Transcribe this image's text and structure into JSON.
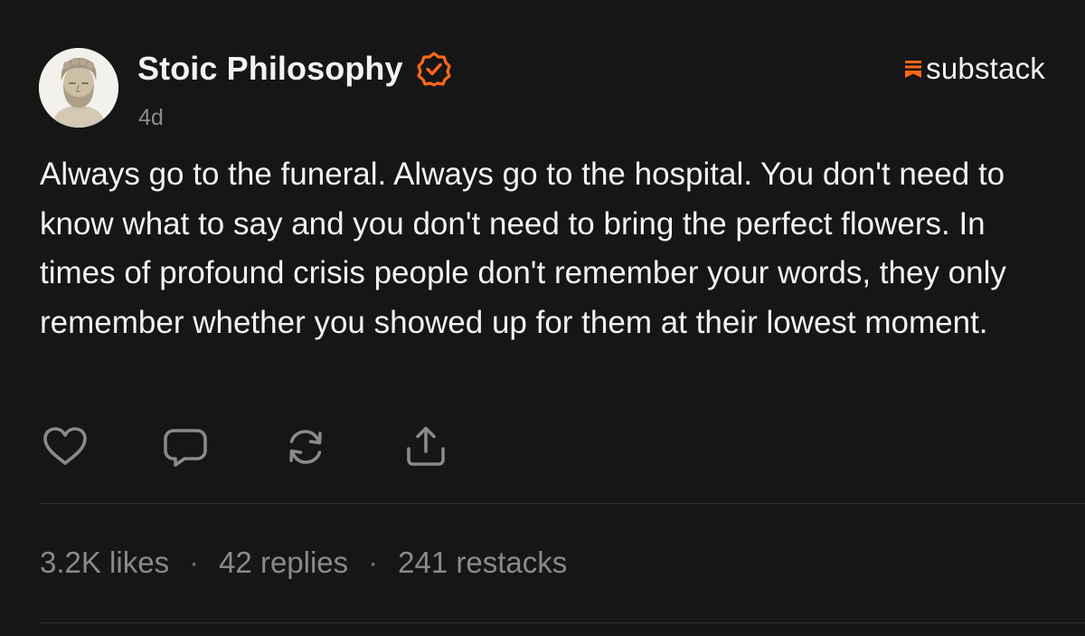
{
  "post": {
    "author": "Stoic Philosophy",
    "verified": true,
    "time": "4d",
    "brand": "substack",
    "body": "Always go to the funeral. Always go to the hospital. You don't need to know what to say and you don't need to bring the perfect flowers. In times of profound crisis people don't remember your words, they only remember whether you showed up for them at their lowest moment."
  },
  "actions": {
    "like_icon": "heart-icon",
    "reply_icon": "comment-icon",
    "restack_icon": "restack-icon",
    "share_icon": "share-icon"
  },
  "stats": {
    "likes": "3.2K likes",
    "replies": "42 replies",
    "restacks": "241 restacks",
    "separator": "·"
  },
  "colors": {
    "background": "#161616",
    "text": "#f2f2f2",
    "muted": "#8a8a8a",
    "accent": "#ff6719"
  }
}
